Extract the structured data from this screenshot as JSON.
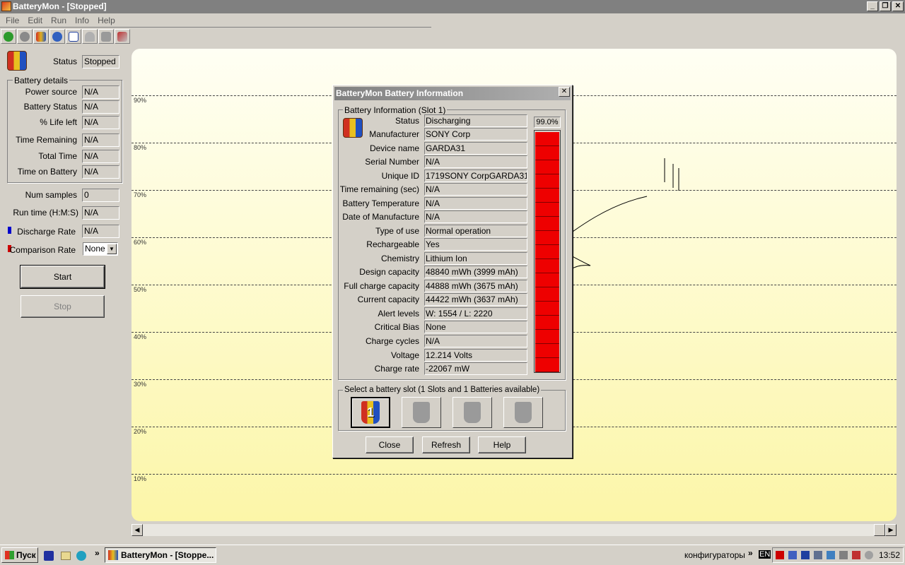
{
  "window": {
    "title": "BatteryMon - [Stopped]"
  },
  "menu": [
    "File",
    "Edit",
    "Run",
    "Info",
    "Help"
  ],
  "toolbar": [
    "check-icon",
    "stop-icon",
    "battery-icon",
    "info-icon",
    "checklist-icon",
    "gauge-icon",
    "tools-icon",
    "settings-icon"
  ],
  "left": {
    "status_label": "Status",
    "status_value": "Stopped",
    "details_title": "Battery details",
    "details": [
      {
        "label": "Power source",
        "value": "N/A"
      },
      {
        "label": "Battery Status",
        "value": "N/A"
      },
      {
        "label": "% Life left",
        "value": "N/A"
      },
      {
        "label": "Time Remaining",
        "value": "N/A"
      },
      {
        "label": "Total Time",
        "value": "N/A"
      },
      {
        "label": "Time on Battery",
        "value": "N/A"
      }
    ],
    "num_samples_label": "Num samples",
    "num_samples_value": "0",
    "run_time_label": "Run time (H:M:S)",
    "run_time_value": "N/A",
    "discharge_label": "Discharge Rate",
    "discharge_value": "N/A",
    "comparison_label": "Comparison Rate",
    "comparison_value": "None",
    "start_label": "Start",
    "stop_label": "Stop"
  },
  "chart": {
    "gridlines": [
      "90%",
      "80%",
      "70%",
      "60%",
      "50%",
      "40%",
      "30%",
      "20%",
      "10%"
    ]
  },
  "dialog": {
    "title": "BatteryMon Battery Information",
    "group_title": "Battery Information (Slot 1)",
    "percent": "99.0%",
    "level": 0.99,
    "rows": [
      {
        "label": "Status",
        "value": "Discharging"
      },
      {
        "label": "Manufacturer",
        "value": "SONY Corp"
      },
      {
        "label": "Device name",
        "value": "GARDA31"
      },
      {
        "label": "Serial Number",
        "value": "N/A"
      },
      {
        "label": "Unique ID",
        "value": "1719SONY CorpGARDA31"
      },
      {
        "label": "Time remaining (sec)",
        "value": "N/A"
      },
      {
        "label": "Battery Temperature",
        "value": "N/A"
      },
      {
        "label": "Date of Manufacture",
        "value": "N/A"
      },
      {
        "label": "Type of use",
        "value": "Normal operation"
      },
      {
        "label": "Rechargeable",
        "value": "Yes"
      },
      {
        "label": "Chemistry",
        "value": "Lithium Ion"
      },
      {
        "label": "Design capacity",
        "value": "48840 mWh (3999 mAh)"
      },
      {
        "label": "Full charge capacity",
        "value": "44888 mWh (3675 mAh)"
      },
      {
        "label": "Current capacity",
        "value": "44422 mWh (3637 mAh)"
      },
      {
        "label": "Alert levels",
        "value": "W: 1554 / L: 2220"
      },
      {
        "label": "Critical Bias",
        "value": "None"
      },
      {
        "label": "Charge cycles",
        "value": "N/A"
      },
      {
        "label": "Voltage",
        "value": "12.214 Volts"
      },
      {
        "label": "Charge rate",
        "value": "-22067 mW"
      }
    ],
    "slot_group_title": "Select a battery slot (1 Slots and 1 Batteries available)",
    "selected_slot": "1",
    "close_label": "Close",
    "refresh_label": "Refresh",
    "help_label": "Help"
  },
  "taskbar": {
    "start_label": "Пуск",
    "task_label": "BatteryMon - [Stoppe...",
    "toolbar_label": "конфигураторы",
    "lang": "EN",
    "clock": "13:52",
    "chevron": "»"
  }
}
